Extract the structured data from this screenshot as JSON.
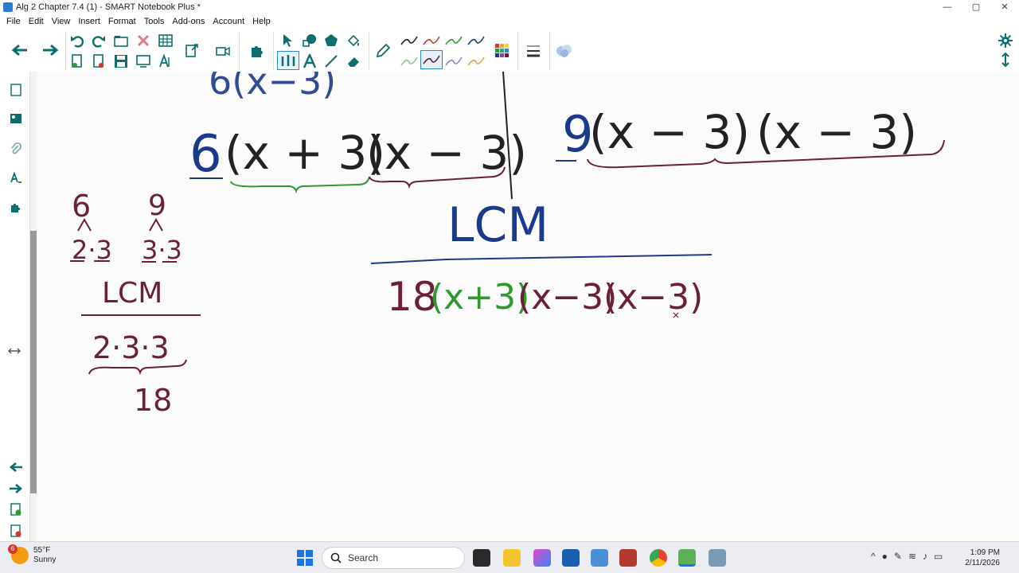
{
  "window": {
    "title": "Alg 2 Chapter 7.4 (1) - SMART Notebook Plus *",
    "minimize": "—",
    "maximize": "▢",
    "close": "✕"
  },
  "menu": [
    "File",
    "Edit",
    "View",
    "Insert",
    "Format",
    "Tools",
    "Add-ons",
    "Account",
    "Help"
  ],
  "colors": {
    "accent": "#0e6e6e",
    "ink_blue": "#1b3a8c",
    "ink_maroon": "#6b1f3a",
    "ink_green": "#2e9a2e"
  },
  "icons": {
    "back": "arrow-left-icon",
    "forward": "arrow-right-icon",
    "undo": "undo-icon",
    "redo": "redo-icon",
    "delete": "delete-icon",
    "table": "table-icon",
    "select": "select-arrow-icon",
    "pen": "pen-icon",
    "settings": "gear-icon"
  },
  "board": {
    "top_left_partial": "6(x−3)",
    "left_expr": {
      "coef": "6",
      "factor1": "(x + 3)",
      "factor2": "(x − 3)"
    },
    "right_expr": {
      "coef": "9",
      "factor1": "(x − 3)",
      "factor2": "(x − 3)"
    },
    "lcm_heading": "LCM",
    "lcm_result": {
      "coef": "18",
      "factor1": "(x+3)",
      "factor2": "(x−3)",
      "factor3": "(x−3)"
    },
    "side_work": {
      "six": "6",
      "nine": "9",
      "six_factors": "2·3",
      "nine_factors": "3·3",
      "lcm_label": "LCM",
      "lcm_factors": "2·3·3",
      "lcm_number": "18"
    }
  },
  "taskbar": {
    "weather_temp": "55°F",
    "weather_desc": "Sunny",
    "weather_badge": "6",
    "search_label": "Search",
    "time": "1:09 PM",
    "date": "2/11/2026"
  }
}
